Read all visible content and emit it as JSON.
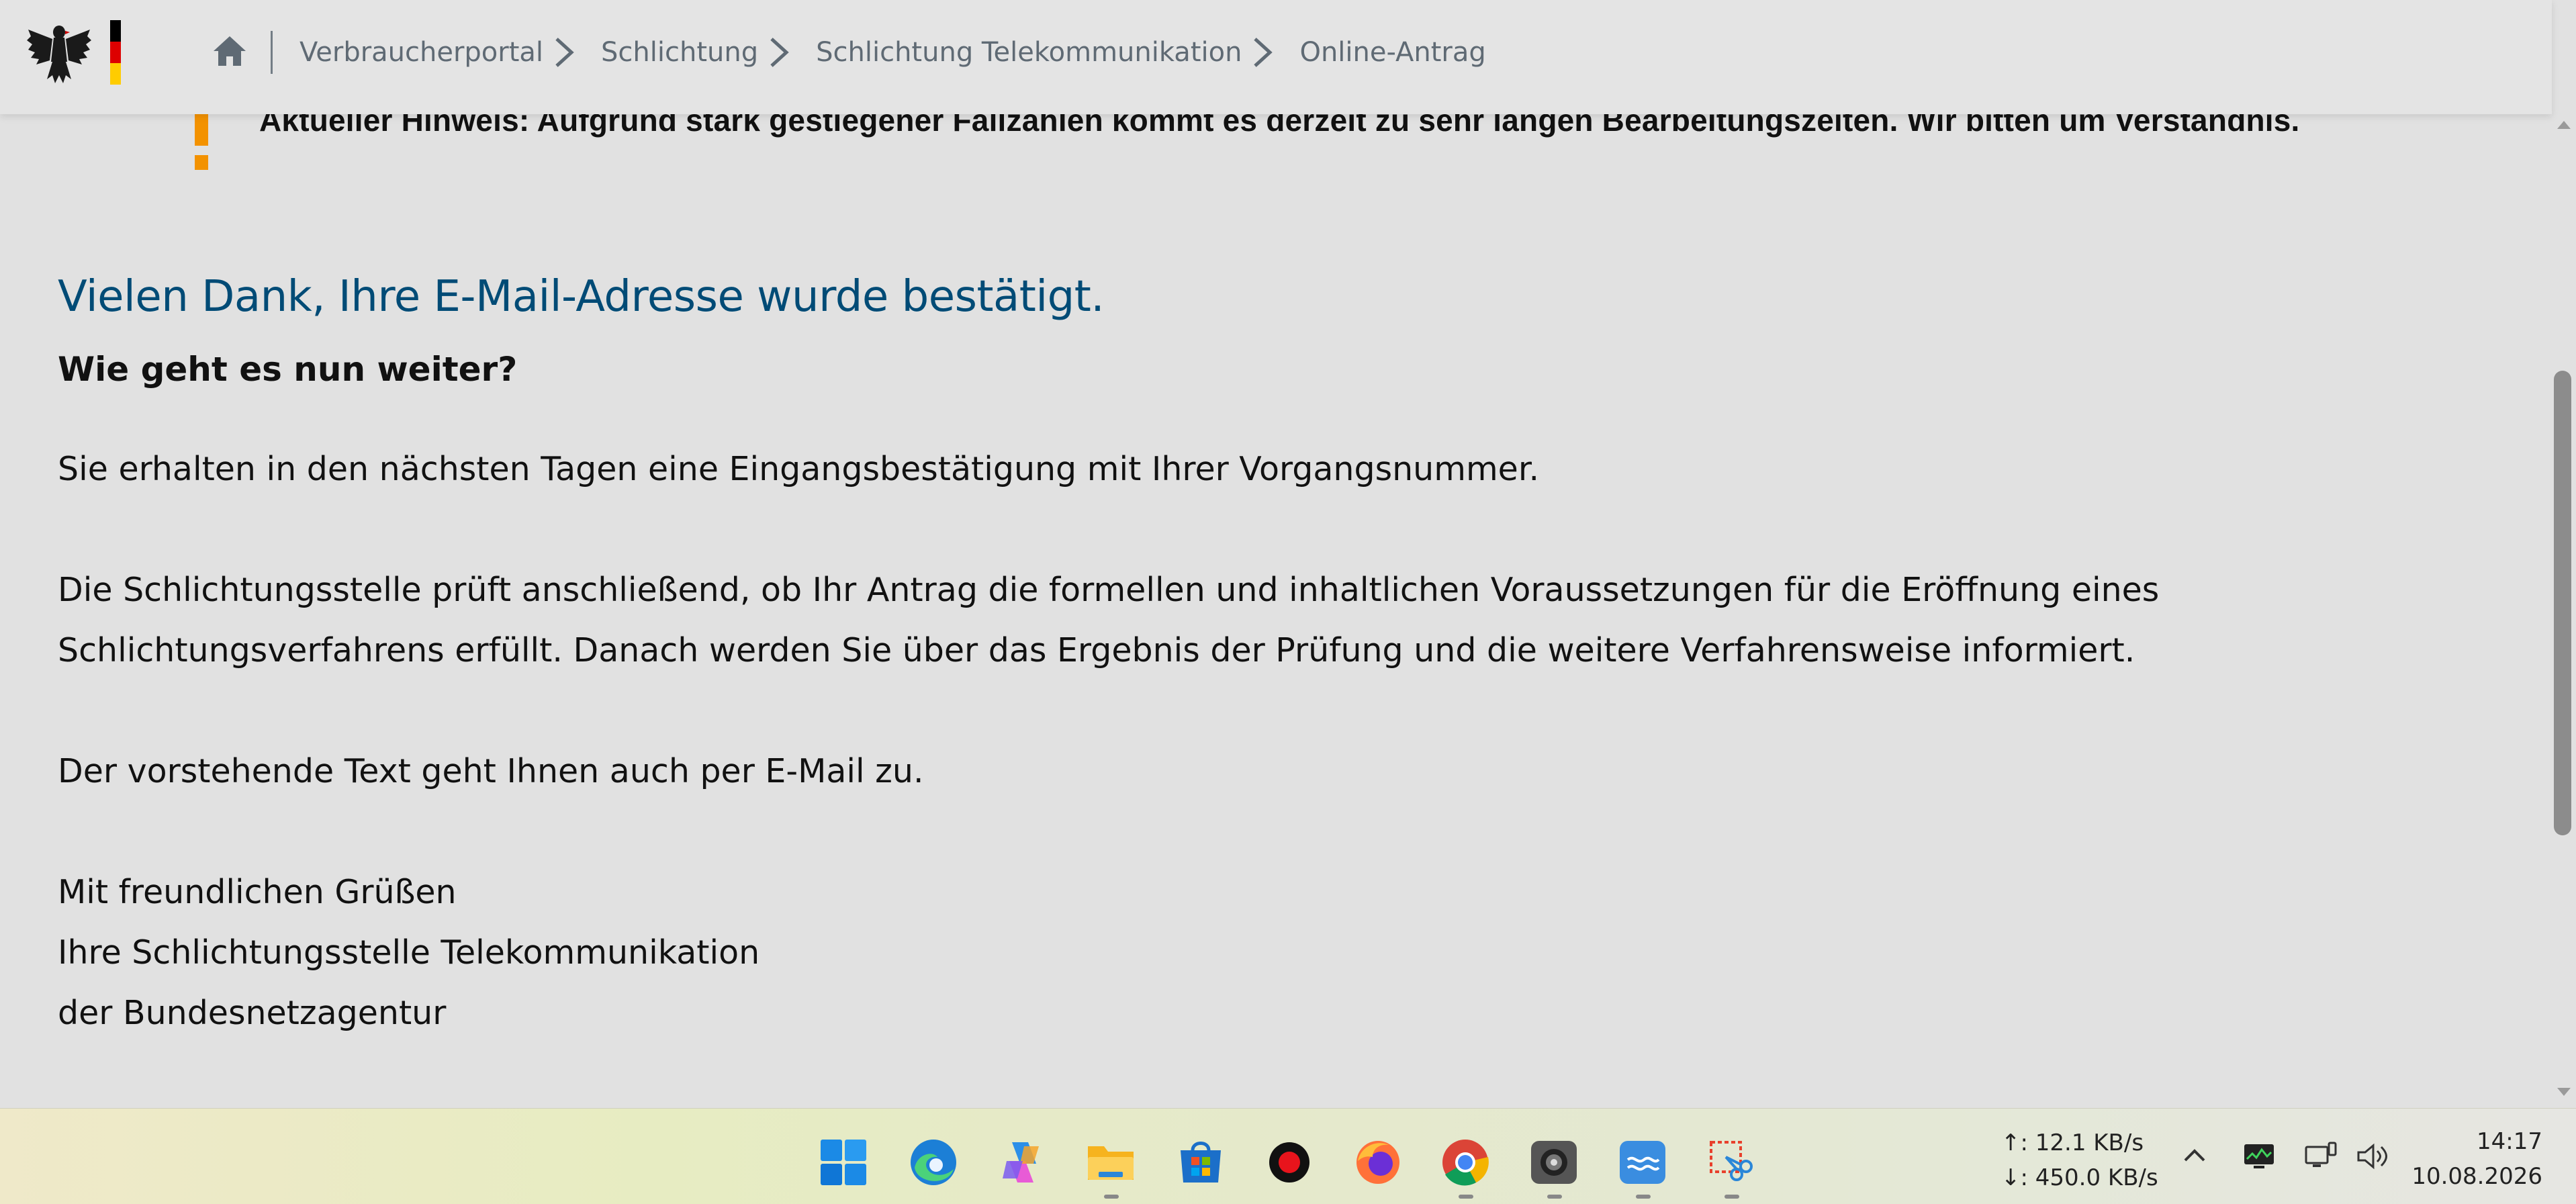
{
  "header": {
    "logo_label": "Bundesadler",
    "flag_colors": [
      "#000000",
      "#dd0000",
      "#ffcc00"
    ],
    "breadcrumb": [
      {
        "label": "Verbraucherportal"
      },
      {
        "label": "Schlichtung"
      },
      {
        "label": "Schlichtung Telekommunikation"
      },
      {
        "label": "Online-Antrag"
      }
    ]
  },
  "notice": {
    "icon": "exclamation-icon",
    "icon_color": "#f39200",
    "text": "Aktueller Hinweis: Aufgrund stark gestiegener Fallzahlen kommt es derzeit zu sehr langen Bearbeitungszeiten. Wir bitten um Verständnis."
  },
  "content": {
    "title": "Vielen Dank, Ihre E-Mail-Adresse wurde bestätigt.",
    "title_color": "#004b76",
    "subheading": "Wie geht es nun weiter?",
    "paragraph1": "Sie erhalten in den nächsten Tagen eine Eingangsbestätigung mit Ihrer Vorgangsnummer.",
    "paragraph2_line1": "Die Schlichtungsstelle prüft anschließend, ob Ihr Antrag die formellen und inhaltlichen Voraussetzungen für die Eröffnung eines",
    "paragraph2_line2": "Schlichtungsverfahrens erfüllt. Danach werden Sie über das Ergebnis der Prüfung und die weitere Verfahrensweise informiert.",
    "paragraph3": "Der vorstehende Text geht Ihnen auch per E-Mail zu.",
    "closing1": "Mit freundlichen Grüßen",
    "closing2": "Ihre Schlichtungsstelle Telekommunikation",
    "closing3": "der Bundesnetzagentur"
  },
  "taskbar": {
    "apps": [
      "windows-start-icon",
      "edge-icon",
      "copilot-icon",
      "file-explorer-icon",
      "store-icon",
      "record-icon",
      "firefox-icon",
      "chrome-icon",
      "camera-icon",
      "vpn-app-icon",
      "snipping-tool-icon"
    ],
    "net_up": "↑: 12.1 KB/s",
    "net_down": "↓: 450.0 KB/s",
    "time": "14:17",
    "date": "10.08.2026"
  }
}
